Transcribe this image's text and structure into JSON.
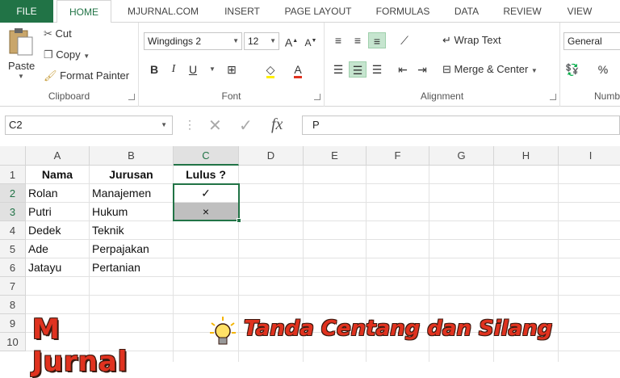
{
  "tabs": [
    "FILE",
    "HOME",
    "MJURNAL.COM",
    "INSERT",
    "PAGE LAYOUT",
    "FORMULAS",
    "DATA",
    "REVIEW",
    "VIEW"
  ],
  "clipboard": {
    "paste": "Paste",
    "cut": "Cut",
    "copy": "Copy",
    "format_painter": "Format Painter",
    "label": "Clipboard"
  },
  "font": {
    "name": "Wingdings 2",
    "size": "12",
    "label": "Font"
  },
  "alignment": {
    "wrap": "Wrap Text",
    "merge": "Merge & Center",
    "label": "Alignment"
  },
  "number": {
    "format": "General",
    "label": "Numb"
  },
  "formula_bar": {
    "name_box": "C2",
    "fx": "fx",
    "value": "P"
  },
  "columns": [
    "A",
    "B",
    "C",
    "D",
    "E",
    "F",
    "G",
    "H",
    "I"
  ],
  "rows": [
    "1",
    "2",
    "3",
    "4",
    "5",
    "6",
    "7",
    "8",
    "9",
    "10"
  ],
  "headers": {
    "a": "Nama",
    "b": "Jurusan",
    "c": "Lulus ?"
  },
  "data": [
    {
      "name": "Rolan",
      "major": "Manajemen",
      "mark": "✓"
    },
    {
      "name": "Putri",
      "major": "Hukum",
      "mark": "×"
    },
    {
      "name": "Dedek",
      "major": "Teknik",
      "mark": ""
    },
    {
      "name": "Ade",
      "major": "Perpajakan",
      "mark": ""
    },
    {
      "name": "Jatayu",
      "major": "Pertanian",
      "mark": ""
    }
  ],
  "banner": {
    "brand": "M Jurnal",
    "subtitle": "Tanda Centang dan Silang"
  },
  "colors": {
    "accent": "#217346",
    "banner_red": "#e0321f"
  }
}
